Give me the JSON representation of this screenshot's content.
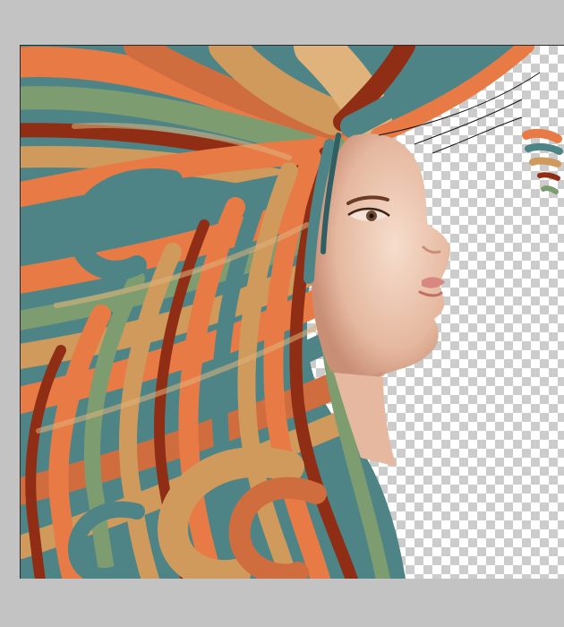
{
  "app": {
    "document_background": "#c3c3c3",
    "canvas_border": "#2a2a2a"
  },
  "canvas": {
    "transparency_pattern": {
      "light": "#ffffff",
      "dark": "#cccccc"
    },
    "artwork": {
      "subject": "woman-face-profile-with-flowing-stylized-hair",
      "palette": [
        "#e87b45",
        "#4f8486",
        "#2f5f62",
        "#cf9a5c",
        "#7d9d71",
        "#8f2d15",
        "#e0b37c",
        "#d06d3f"
      ],
      "skin_tones": [
        "#f6ddcc",
        "#e5b89f",
        "#c98e76"
      ]
    }
  }
}
